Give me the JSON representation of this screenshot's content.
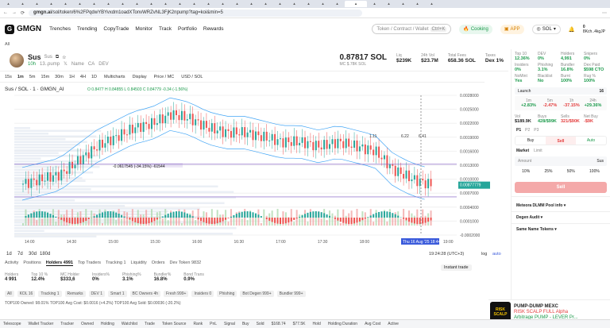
{
  "browser": {
    "url_domain": "gmgn.ai",
    "url_path": "/sol/token/6%2FPqdwYBYvxdm1oadXTonvWRZvNL3FjK2npump?tag=koi&min=5",
    "tab_count": 30
  },
  "app": {
    "logo": "GMGN",
    "nav": [
      "Trenches",
      "Trending",
      "CopyTrade",
      "Monitor",
      "Track",
      "Portfolio",
      "Rewards"
    ],
    "search_placeholder": "Token / Contract / Wallet",
    "search_shortcut": "Ctrl+K",
    "cooking": "Cooking",
    "app_label": "APP",
    "chain": "SOL",
    "wallet_balance": "0",
    "wallet_addr": "8Kch..4kgJP",
    "all_label": "All"
  },
  "token": {
    "symbol": "Sus",
    "name": "Sus",
    "age": "10h",
    "mention": "13..pump",
    "price": "0.87817 SOL",
    "mc_label": "MC",
    "mc": "$.78K SOL",
    "stats": [
      {
        "label": "Liq",
        "value": "$239K"
      },
      {
        "label": "24h Vol",
        "value": "$23.7M"
      },
      {
        "label": "Total Fees",
        "value": "658.36 SOL"
      },
      {
        "label": "Taxes",
        "value": "Dex 1%"
      }
    ]
  },
  "chart": {
    "intervals": [
      "15s",
      "1m",
      "5m",
      "15m",
      "30m",
      "1H",
      "4H",
      "1D"
    ],
    "multicharts": "Multicharts",
    "display": "Display",
    "price_mc": "Price / MC",
    "usd_sol": "USD / SOL",
    "legend": "Sus / SOL · 1 · GMGN_AI",
    "ohlc": "O 0.8477 H 0.84855 L 0.84503 C 0.84779 -0.34 (-1.56%)",
    "yticks": [
      "0.0028000",
      "0.0025000",
      "0.0022000",
      "0.0019000",
      "0.0016000",
      "0.0013000",
      "0.0010000",
      "0.0007000",
      "0.0004000",
      "0.0001000",
      "-0.0002000"
    ],
    "xticks": [
      "14:00",
      "14:30",
      "15:00",
      "15:30",
      "16:00",
      "16:30",
      "17:00",
      "17:30",
      "18:00",
      "18:30",
      "19:00"
    ],
    "current_price_label": "0.00877779",
    "measure_label": "-0.0617545 (-34.15%) -61544",
    "time_label": "19:24:28 (UTC+3)",
    "crosshair_date": "Thu 16 Aug '25 18:44",
    "marks": [
      "1.11",
      "6.22",
      "6.41"
    ],
    "ranges": [
      "1d",
      "7d",
      "30d",
      "180d"
    ],
    "log": "log",
    "pct": "%",
    "auto": "auto"
  },
  "chart_data": {
    "type": "candlestick",
    "ylim": [
      -0.0002,
      0.0028
    ],
    "close_trend": [
      0.0009,
      0.001,
      0.0011,
      0.0014,
      0.0017,
      0.0019,
      0.0021,
      0.0022,
      0.0024,
      0.0023,
      0.0021,
      0.002,
      0.002,
      0.0019,
      0.0018,
      0.0018,
      0.0017,
      0.0018,
      0.0017,
      0.0016,
      0.0012,
      0.001,
      0.00088
    ]
  },
  "bottom": {
    "tabs": [
      "Activity",
      "Positions",
      "Holders 4991",
      "Top Traders",
      "Tracking 1",
      "Liquidity",
      "Orders",
      "Dev Token 9832"
    ],
    "instant": "Instant trade",
    "stats": [
      {
        "label": "Holders",
        "value": "4 991"
      },
      {
        "label": "Top 10 %",
        "value": "12.4%"
      },
      {
        "label": "MC Holder",
        "value": "$333,6"
      },
      {
        "label": "Insiders%",
        "value": "0%"
      },
      {
        "label": "Phishing%",
        "value": "3.1%"
      },
      {
        "label": "Bundler%",
        "value": "16.8%"
      },
      {
        "label": "Bond Trans",
        "value": "0.9%"
      }
    ],
    "filters": [
      "All",
      "KOL 16",
      "Tracking 1",
      "Remarks",
      "DEV 1",
      "Smart 1",
      "BC Owners 4h",
      "Fresh 999+",
      "Insiders 0",
      "Phishing",
      "Bot Degen 999+",
      "Bundler 999+"
    ],
    "top_line": "TOP100 Owned: 98.01%   TOP100 Avg Cost: $0.0016 (+4.2%)   TOP100 Avg Sold: $0.00036 (-20.2%)"
  },
  "right": {
    "stats": [
      {
        "label": "Top 10",
        "value": "12.36%"
      },
      {
        "label": "DEV",
        "value": "0%"
      },
      {
        "label": "Holders",
        "value": "4,991"
      },
      {
        "label": "Snipers",
        "value": "0%"
      },
      {
        "label": "Insiders",
        "value": "0%"
      },
      {
        "label": "Phishing",
        "value": "3.1%"
      },
      {
        "label": "Bundler",
        "value": "16.8%"
      },
      {
        "label": "Dex Paid",
        "value": "$598 CTO"
      },
      {
        "label": "NoMint",
        "value": "Yes"
      },
      {
        "label": "Blacklist",
        "value": "No"
      },
      {
        "label": "Burnt",
        "value": "100%"
      },
      {
        "label": "Rug %",
        "value": "100%"
      }
    ],
    "launch": "Launch",
    "launch_val": "16",
    "periods": [
      {
        "label": "1m",
        "value": "+2.83%"
      },
      {
        "label": "5m",
        "value": "-2.47%"
      },
      {
        "label": "1h",
        "value": "-37.15%"
      },
      {
        "label": "24h",
        "value": "+29.36%"
      }
    ],
    "vol": {
      "vol": "$189.9K",
      "buys": "428/$99K",
      "sells": "321/$90K",
      "net": "-$9K"
    },
    "presets": [
      "P1",
      "P2",
      "P3"
    ],
    "buy": "Buy",
    "sell": "Sell",
    "auto": "Auto",
    "market": "Market",
    "limit": "Limit",
    "amount": "Amount",
    "sus": "Sus",
    "pcts": [
      "10%",
      "25%",
      "50%",
      "100%"
    ],
    "sell_btn": "Sell",
    "pool": "Meteora DLMM Pool info",
    "degen": "Degen Audit",
    "same": "Same Name Tokens"
  },
  "promo": {
    "title": "PUMP-DUMP MEXC",
    "line2": "RISK SCALP FULL Alpha",
    "line3": "Arbitrage PUMP - LEVER Pr..."
  },
  "taskbar": [
    "Telescope",
    "Wallet Tracker",
    "Tracker",
    "Owned",
    "Holding",
    "Watchlist",
    "Trade",
    "Token Source",
    "Rank",
    "PnL",
    "Signal",
    "Buy",
    "Sold",
    "$168.74",
    "$77.5K",
    "Hold",
    "Holding Duration",
    "Avg Cost",
    "Active"
  ]
}
